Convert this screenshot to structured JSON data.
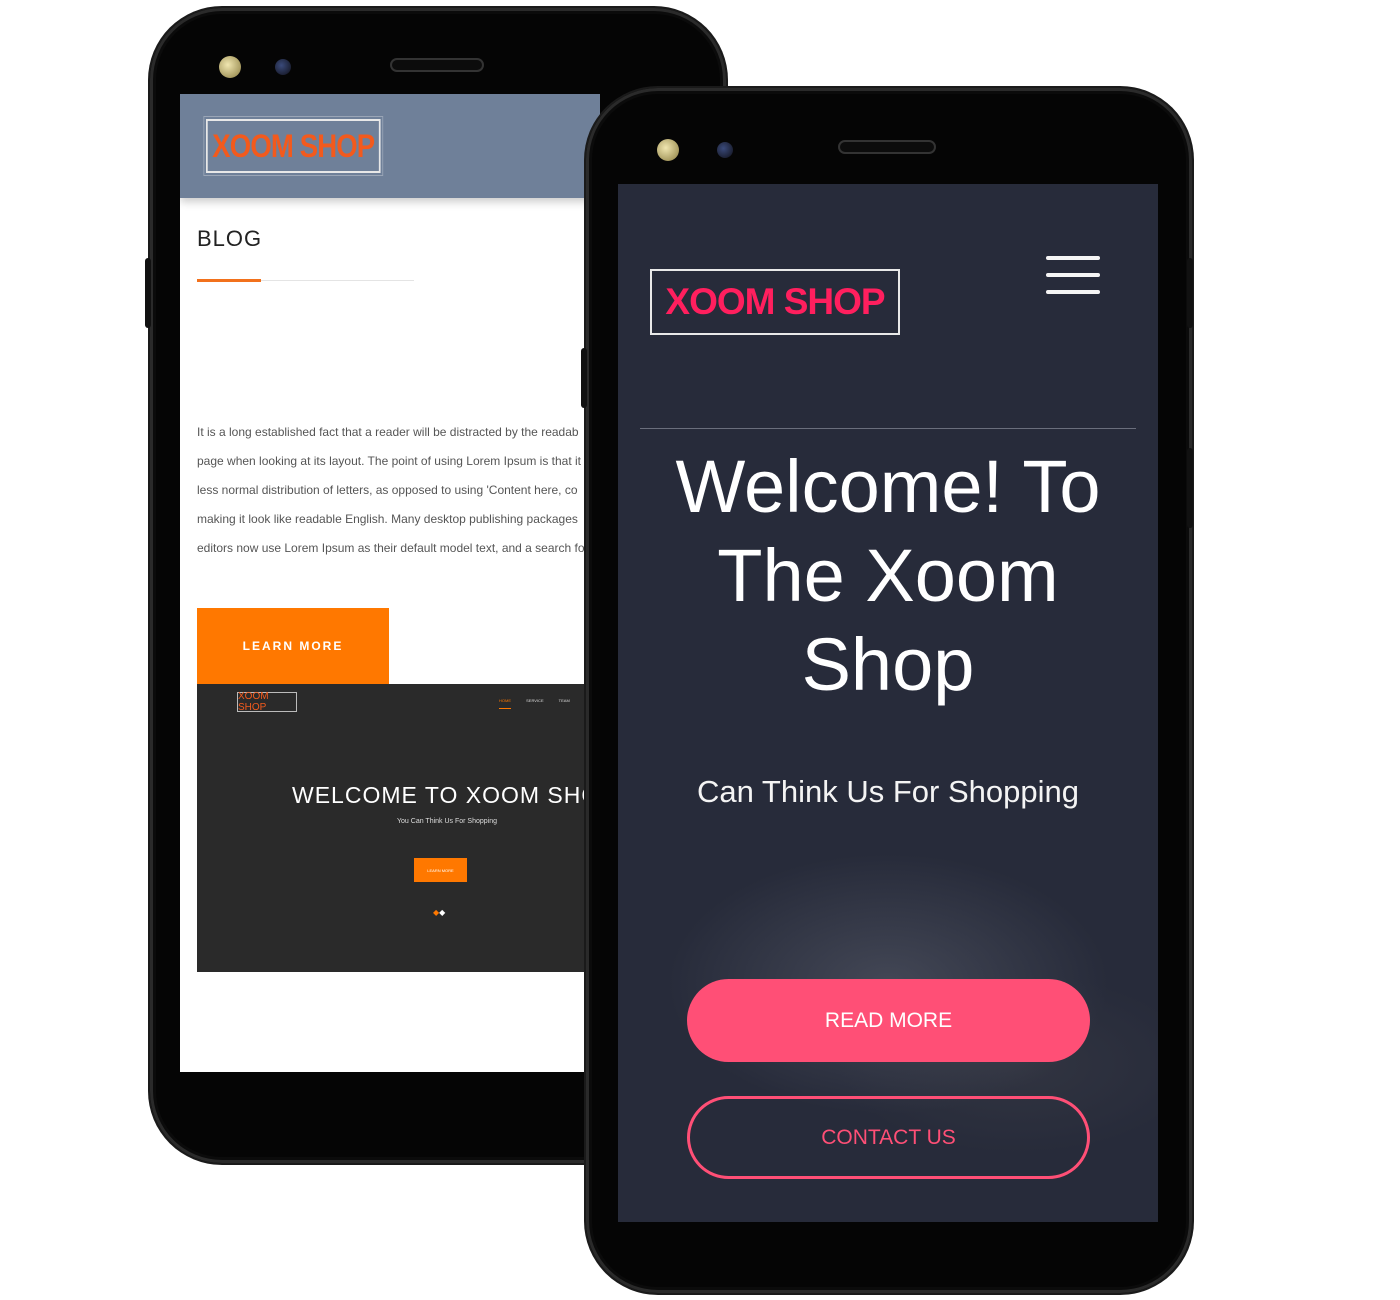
{
  "back_phone": {
    "logo": "XOOM SHOP",
    "blog_title": "BLOG",
    "blog_text_lines": [
      "It is a long established fact that a reader will be distracted by the readab",
      "page when looking at its layout. The point of using Lorem Ipsum is that it",
      "less normal distribution of letters, as opposed to using 'Content here, co",
      "making it look like readable English. Many desktop publishing packages",
      "editors now use Lorem Ipsum as their default model text, and a search fo"
    ],
    "learn_more": "LEARN MORE",
    "mini_site": {
      "logo": "XOOM SHOP",
      "nav": [
        "HOME",
        "SERVICE",
        "TEAM"
      ],
      "welcome": "WELCOME TO XOOM SHOP",
      "subtitle": "You Can Think Us For Shopping",
      "button": "LEARN MORE"
    }
  },
  "front_phone": {
    "logo": "XOOM SHOP",
    "welcome_lines": [
      "Welcome! To",
      "The Xoom",
      "Shop"
    ],
    "tagline": "Can Think Us For Shopping",
    "read_more": "READ MORE",
    "contact_us": "CONTACT US"
  },
  "colors": {
    "orange_accent": "#ff7800",
    "pink_accent": "#ff4f76",
    "front_bg": "#272b3a",
    "back_header": "#6f8099"
  }
}
